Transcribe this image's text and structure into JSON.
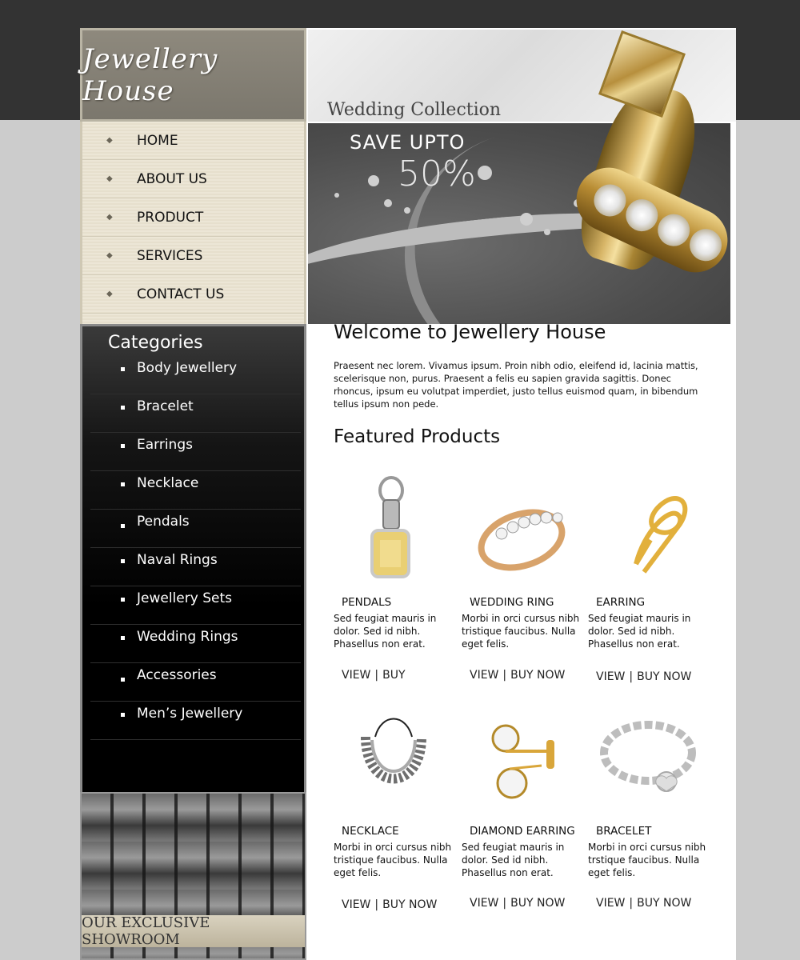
{
  "site": {
    "logo_text": "Jewellery House"
  },
  "banner": {
    "collection": "Wedding Collection",
    "save_line": "SAVE UPTO",
    "save_percent": "50%"
  },
  "nav": {
    "items": [
      {
        "label": "HOME"
      },
      {
        "label": "ABOUT US"
      },
      {
        "label": "PRODUCT"
      },
      {
        "label": "SERVICES"
      },
      {
        "label": "CONTACT US"
      }
    ]
  },
  "categories": {
    "title": "Categories",
    "items": [
      {
        "label": "Body Jewellery"
      },
      {
        "label": "Bracelet"
      },
      {
        "label": "Earrings"
      },
      {
        "label": "Necklace"
      },
      {
        "label": "Pendals"
      },
      {
        "label": "Naval Rings"
      },
      {
        "label": "Jewellery Sets"
      },
      {
        "label": "Wedding Rings"
      },
      {
        "label": "Accessories"
      },
      {
        "label": "Men’s Jewellery"
      }
    ]
  },
  "showroom": {
    "label": "OUR EXCLUSIVE SHOWROOM"
  },
  "main": {
    "welcome_title": "Welcome to Jewellery House",
    "intro": "Praesent nec lorem. Vivamus ipsum. Proin nibh odio, eleifend id, lacinia mattis, scelerisque non, purus. Praesent a felis eu sapien gravida sagittis. Donec rhoncus, ipsum eu volutpat imperdiet, justo tellus euismod quam, in bibendum tellus ipsum non pede.",
    "featured_title": "Featured Products",
    "products": [
      {
        "name": "PENDALS",
        "desc": "Sed feugiat mauris in dolor. Sed id nibh. Phasellus non erat.",
        "view": "VIEW",
        "sep": "|",
        "buy": "BUY"
      },
      {
        "name": "WEDDING RING",
        "desc": "Morbi in orci cursus nibh tristique faucibus. Nulla eget felis.",
        "view": "VIEW",
        "sep": "|",
        "buy": "BUY NOW"
      },
      {
        "name": "EARRING",
        "desc": "Sed feugiat mauris in dolor. Sed id nibh. Phasellus non erat.",
        "view": "VIEW",
        "sep": "|",
        "buy": "BUY NOW"
      },
      {
        "name": "NECKLACE",
        "desc": "Morbi in orci cursus nibh tristique faucibus. Nulla eget felis.",
        "view": "VIEW",
        "sep": "|",
        "buy": "BUY NOW"
      },
      {
        "name": "DIAMOND EARRING",
        "desc": "Sed feugiat mauris in dolor. Sed id nibh. Phasellus non erat.",
        "view": "VIEW",
        "sep": "|",
        "buy": "BUY NOW"
      },
      {
        "name": "BRACELET",
        "desc": "Morbi in orci cursus nibh trstique faucibus. Nulla eget felis.",
        "view": "VIEW",
        "sep": "|",
        "buy": "BUY NOW"
      }
    ]
  },
  "colors": {
    "header_bg": "#333333",
    "page_bg": "#cccccc",
    "nav_bg": "#ece6d6",
    "categories_bg": "#000000",
    "gold": "#d7b567"
  }
}
